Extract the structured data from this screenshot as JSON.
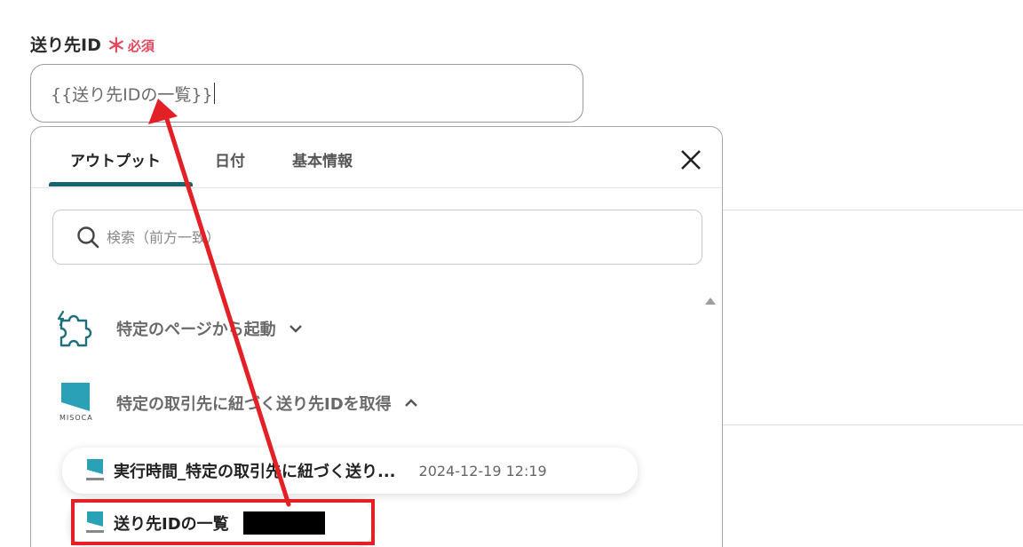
{
  "field": {
    "label": "送り先ID",
    "required_mark": "＊",
    "required_text": "必須",
    "value": "{{送り先IDの一覧}}"
  },
  "popup": {
    "tabs": [
      {
        "label": "アウトプット",
        "active": true
      },
      {
        "label": "日付",
        "active": false
      },
      {
        "label": "基本情報",
        "active": false
      }
    ],
    "search_placeholder": "検索（前方一致）",
    "groups": [
      {
        "label": "特定のページから起動",
        "icon": "puzzle-icon",
        "expanded": false
      },
      {
        "label": "特定の取引先に紐づく送り先IDを取得",
        "icon": "misoca-logo",
        "logo_text": "MISOCA",
        "expanded": true
      }
    ],
    "items": [
      {
        "label": "実行時間_特定の取引先に紐づく送り...",
        "time": "2024-12-19 12:19"
      },
      {
        "label": "送り先IDの一覧",
        "value_redacted": true
      }
    ]
  },
  "colors": {
    "required": "#e2475b",
    "tab_underline": "#14656f",
    "annotation": "#e32026",
    "misoca_brand": "#2aa1b6"
  }
}
